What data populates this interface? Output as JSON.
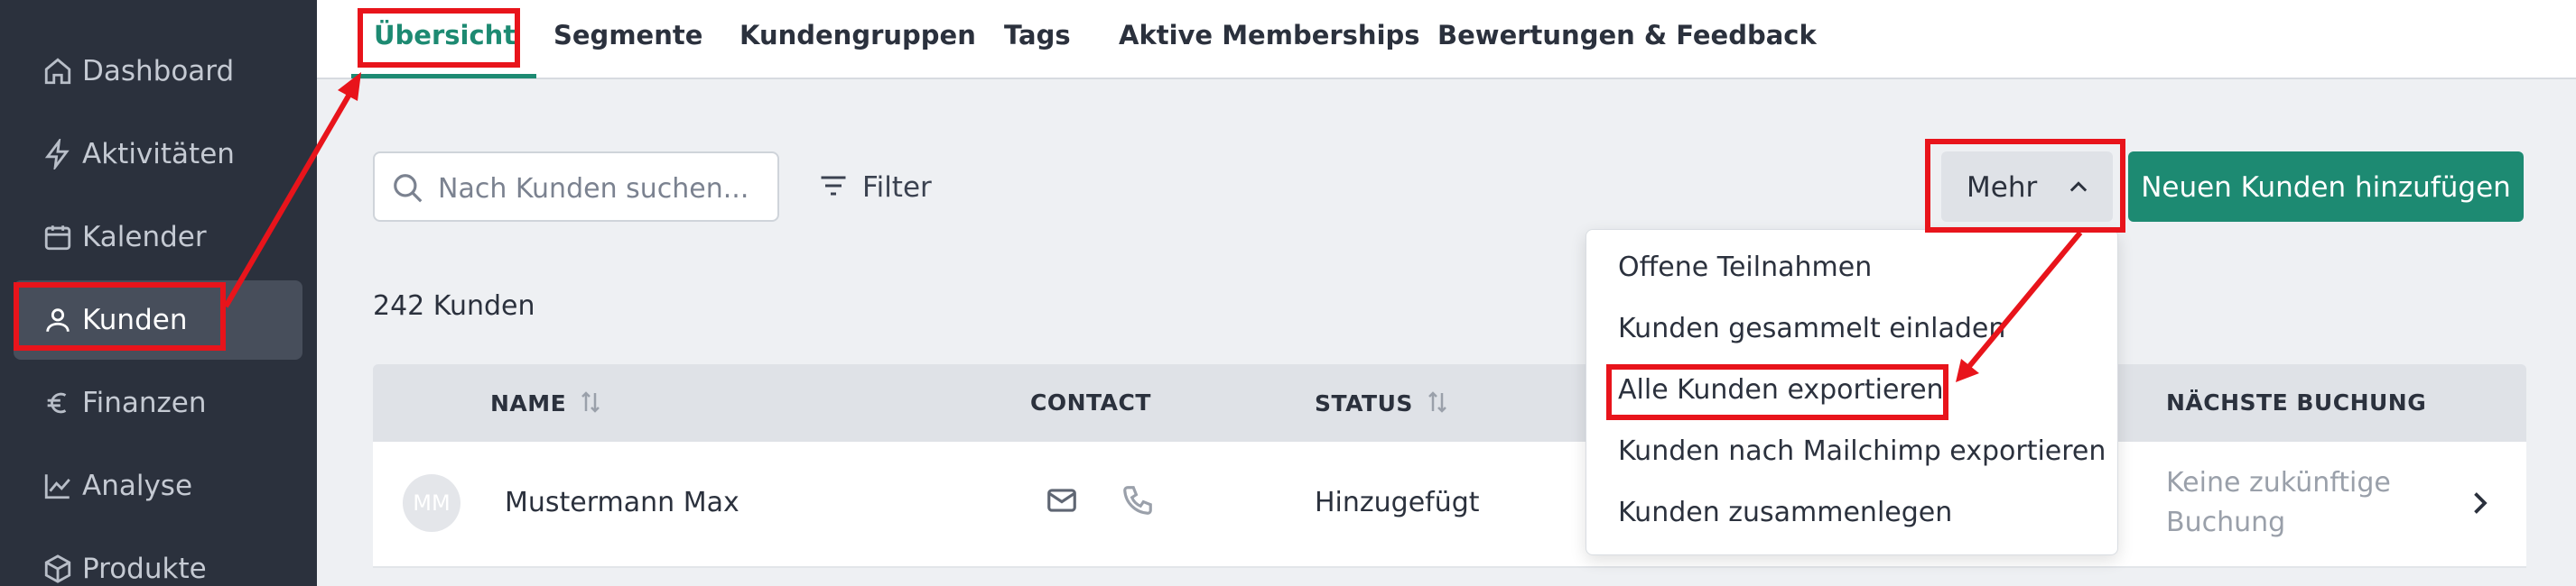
{
  "sidebar": {
    "items": [
      {
        "label": "Dashboard",
        "icon": "home-icon"
      },
      {
        "label": "Aktivitäten",
        "icon": "lightning-icon"
      },
      {
        "label": "Kalender",
        "icon": "calendar-icon"
      },
      {
        "label": "Kunden",
        "icon": "user-icon",
        "active": true
      },
      {
        "label": "Finanzen",
        "icon": "euro-icon"
      },
      {
        "label": "Analyse",
        "icon": "chart-icon"
      },
      {
        "label": "Produkte",
        "icon": "box-icon"
      }
    ]
  },
  "tabs": [
    {
      "label": "Übersicht",
      "active": true
    },
    {
      "label": "Segmente"
    },
    {
      "label": "Kundengruppen"
    },
    {
      "label": "Tags"
    },
    {
      "label": "Aktive Memberships"
    },
    {
      "label": "Bewertungen & Feedback"
    }
  ],
  "toolbar": {
    "search_placeholder": "Nach Kunden suchen...",
    "filter_label": "Filter",
    "mehr_label": "Mehr",
    "add_label": "Neuen Kunden hinzufügen"
  },
  "customer_count": "242 Kunden",
  "table": {
    "headers": {
      "name": "NAME",
      "contact": "CONTACT",
      "status": "STATUS",
      "next_booking": "NÄCHSTE BUCHUNG"
    },
    "rows": [
      {
        "initials": "MM",
        "name": "Mustermann Max",
        "status": "Hinzugefügt",
        "next_booking_line1": "Keine zukünftige",
        "next_booking_line2": "Buchung"
      }
    ]
  },
  "menu": {
    "items": [
      "Offene Teilnahmen",
      "Kunden gesammelt einladen",
      "Alle Kunden exportieren",
      "Kunden nach Mailchimp exportieren",
      "Kunden zusammenlegen"
    ]
  },
  "colors": {
    "sidebar_bg": "#2b313d",
    "accent": "#1d8a72",
    "annotation_red": "#e8141b"
  }
}
